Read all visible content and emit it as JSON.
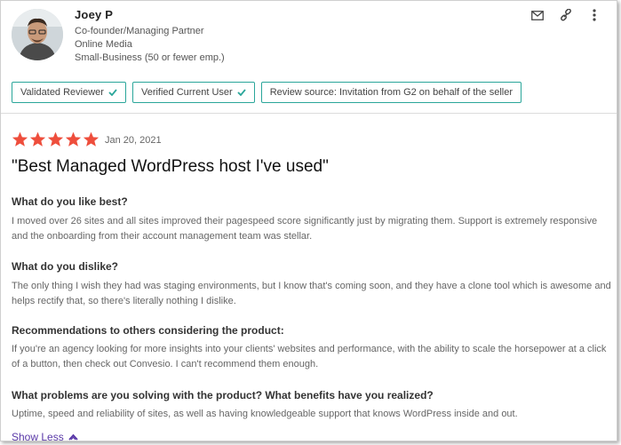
{
  "reviewer": {
    "name": "Joey P",
    "role": "Co-founder/Managing Partner",
    "industry": "Online Media",
    "segment": "Small-Business (50 or fewer emp.)"
  },
  "badges": [
    {
      "label": "Validated Reviewer",
      "icon": "check-icon"
    },
    {
      "label": "Verified Current User",
      "icon": "check-icon"
    },
    {
      "label": "Review source: Invitation from G2 on behalf of the seller"
    }
  ],
  "review": {
    "rating": 5,
    "max_rating": 5,
    "date": "Jan 20, 2021",
    "title": "\"Best Managed WordPress host I've used\""
  },
  "questions": [
    {
      "q": "What do you like best?",
      "a": "I moved over 26 sites and all sites improved their pagespeed score significantly just by migrating them. Support is extremely responsive and the onboarding from their account management team was stellar."
    },
    {
      "q": "What do you dislike?",
      "a": "The only thing I wish they had was staging environments, but I know that's coming soon, and they have a clone tool which is awesome and helps rectify that, so there's literally nothing I dislike."
    },
    {
      "q": "Recommendations to others considering the product:",
      "a": "If you're an agency looking for more insights into your clients' websites and performance, with the ability to scale the horsepower at a click of a button, then check out Convesio. I can't recommend them enough."
    },
    {
      "q": "What problems are you solving with the product? What benefits have you realized?",
      "a": "Uptime, speed and reliability of sites, as well as having knowledgeable support that knows WordPress inside and out."
    }
  ],
  "show_less": "Show Less",
  "colors": {
    "star": "#ee4e3c",
    "badge_border": "#2aa69a",
    "check": "#2aa69a",
    "link": "#5a39a8"
  }
}
